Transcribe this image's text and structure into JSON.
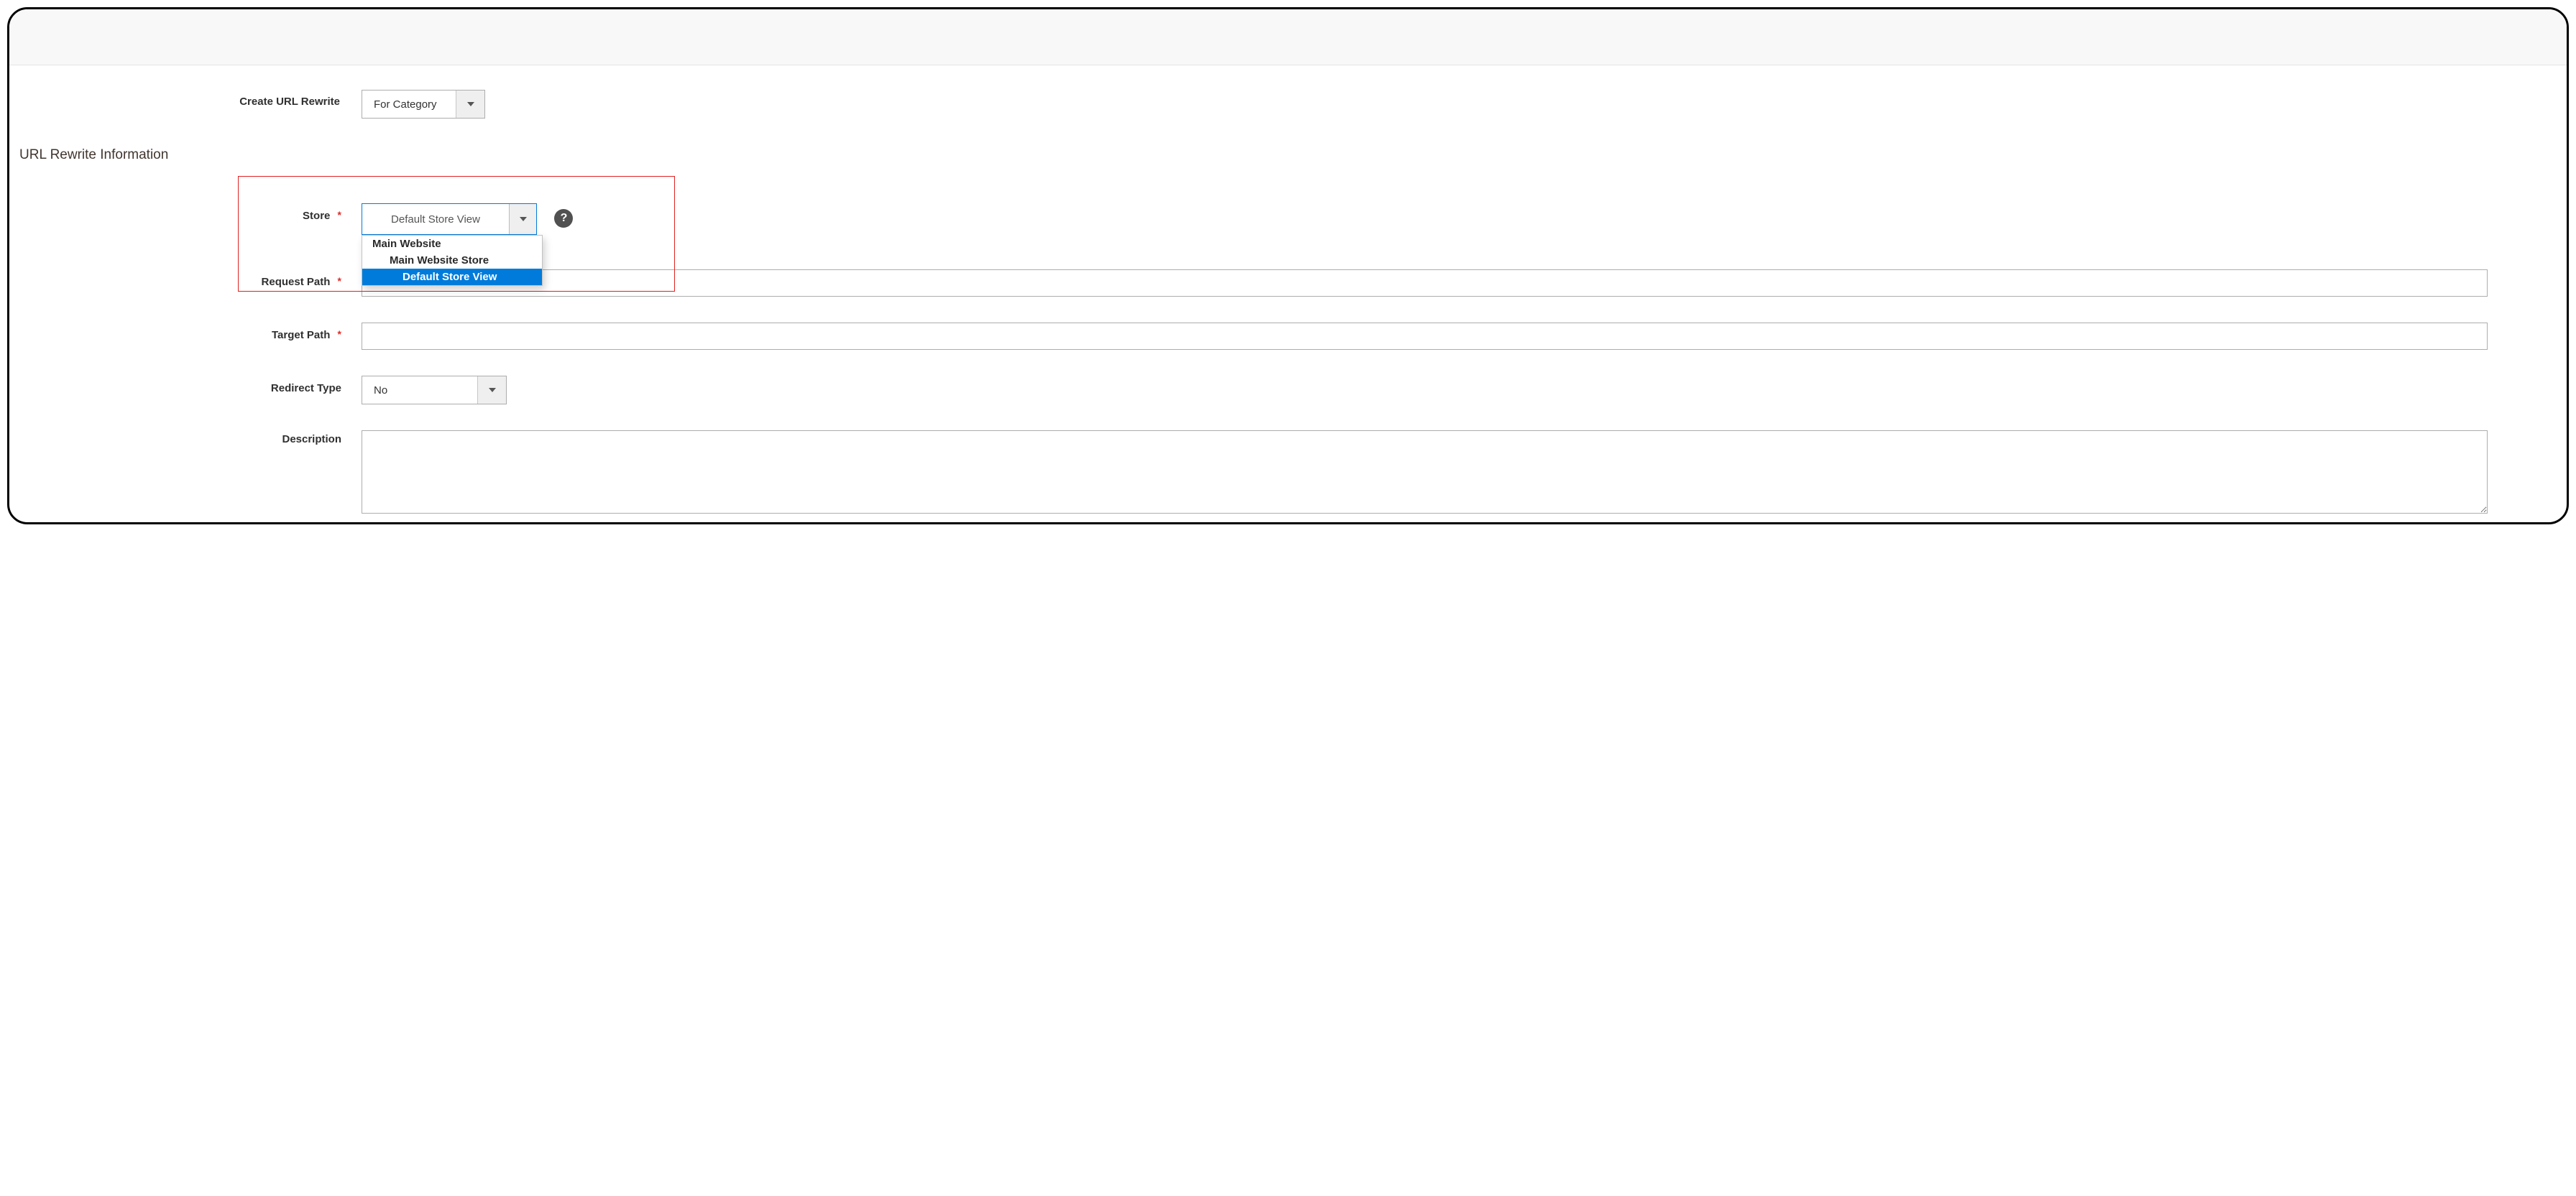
{
  "create": {
    "label": "Create URL Rewrite",
    "value": "For Category"
  },
  "section_title": "URL Rewrite Information",
  "fields": {
    "store": {
      "label": "Store",
      "value": "Default Store View",
      "options": {
        "l1": "Main Website",
        "l2": "Main Website Store",
        "l3": "Default Store View"
      }
    },
    "request_path": {
      "label": "Request Path",
      "value": ""
    },
    "target_path": {
      "label": "Target Path",
      "value": ""
    },
    "redirect_type": {
      "label": "Redirect Type",
      "value": "No"
    },
    "description": {
      "label": "Description",
      "value": ""
    }
  },
  "glyphs": {
    "required": "*",
    "help": "?"
  }
}
